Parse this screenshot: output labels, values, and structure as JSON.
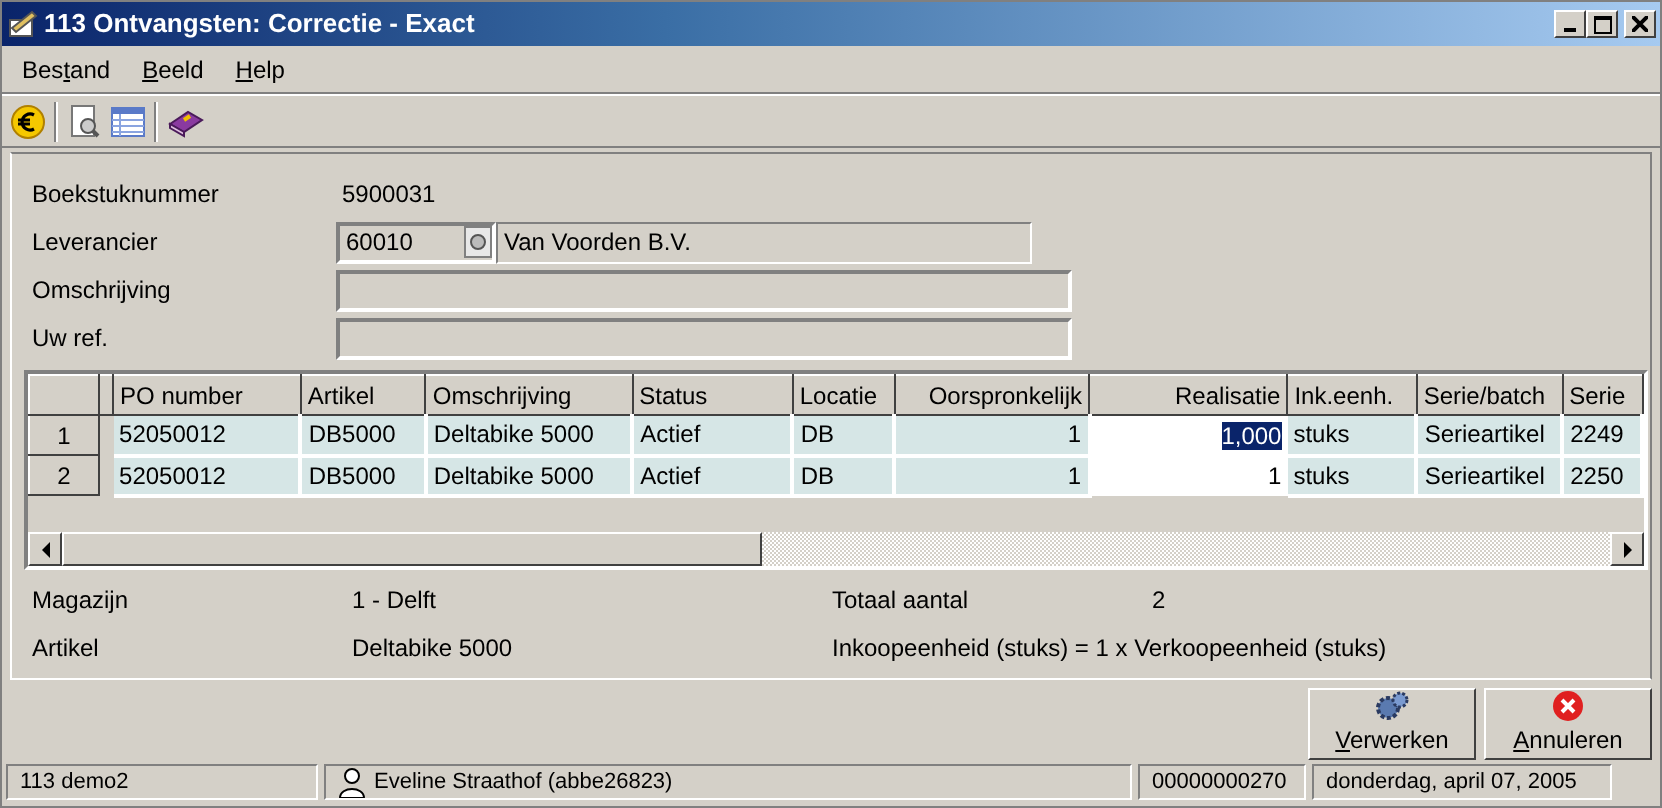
{
  "window": {
    "title": "113 Ontvangsten: Correctie - Exact"
  },
  "menu": [
    {
      "label_before": "Bes",
      "access_key": "t",
      "label_after": "and"
    },
    {
      "access_key": "B",
      "label_after": "eeld"
    },
    {
      "access_key": "H",
      "label_after": "elp"
    }
  ],
  "header": {
    "boekstuk_label": "Boekstuknummer",
    "boekstuk_value": "5900031",
    "leverancier_label": "Leverancier",
    "leverancier_code": "60010",
    "leverancier_name": "Van Voorden B.V.",
    "omschrijving_label": "Omschrijving",
    "uwref_label": "Uw ref."
  },
  "table": {
    "columns": [
      {
        "label": "PO number",
        "kind": "text"
      },
      {
        "label": "Artikel",
        "kind": "text"
      },
      {
        "label": "Omschrijving",
        "kind": "text"
      },
      {
        "label": "Status",
        "kind": "text"
      },
      {
        "label": "Locatie",
        "kind": "text"
      },
      {
        "label": "Oorspronkelijk",
        "kind": "number"
      },
      {
        "label": "Realisatie",
        "kind": "input"
      },
      {
        "label": "Ink.eenh.",
        "kind": "text"
      },
      {
        "label": "Serie/batch",
        "kind": "text"
      },
      {
        "label": "Serie",
        "kind": "text"
      }
    ],
    "rows": [
      {
        "number": "1",
        "editing": true,
        "cells": [
          "52050012",
          "DB5000",
          "Deltabike 5000",
          "Actief",
          "DB",
          "1",
          "1,000",
          "stuks",
          "Serieartikel",
          "2249"
        ]
      },
      {
        "number": "2",
        "editing": false,
        "cells": [
          "52050012",
          "DB5000",
          "Deltabike 5000",
          "Actief",
          "DB",
          "1",
          "1",
          "stuks",
          "Serieartikel",
          "2250"
        ]
      }
    ]
  },
  "summary": {
    "magazijn_label": "Magazijn",
    "magazijn_value": "1 - Delft",
    "artikel_label": "Artikel",
    "artikel_value": "Deltabike 5000",
    "totaal_label": "Totaal aantal",
    "totaal_value": "2",
    "conversion": "Inkoopeenheid (stuks) = 1 x Verkoopeenheid (stuks)"
  },
  "buttons": [
    {
      "access_key": "V",
      "label_after": "erwerken",
      "kind": "process"
    },
    {
      "access_key": "A",
      "label_after": "nnuleren",
      "kind": "cancel"
    }
  ],
  "status_bar": {
    "company": "113 demo2",
    "user": "Eveline Straathof (abbe26823)",
    "number": "00000000270",
    "date": "donderdag, april 07, 2005"
  }
}
